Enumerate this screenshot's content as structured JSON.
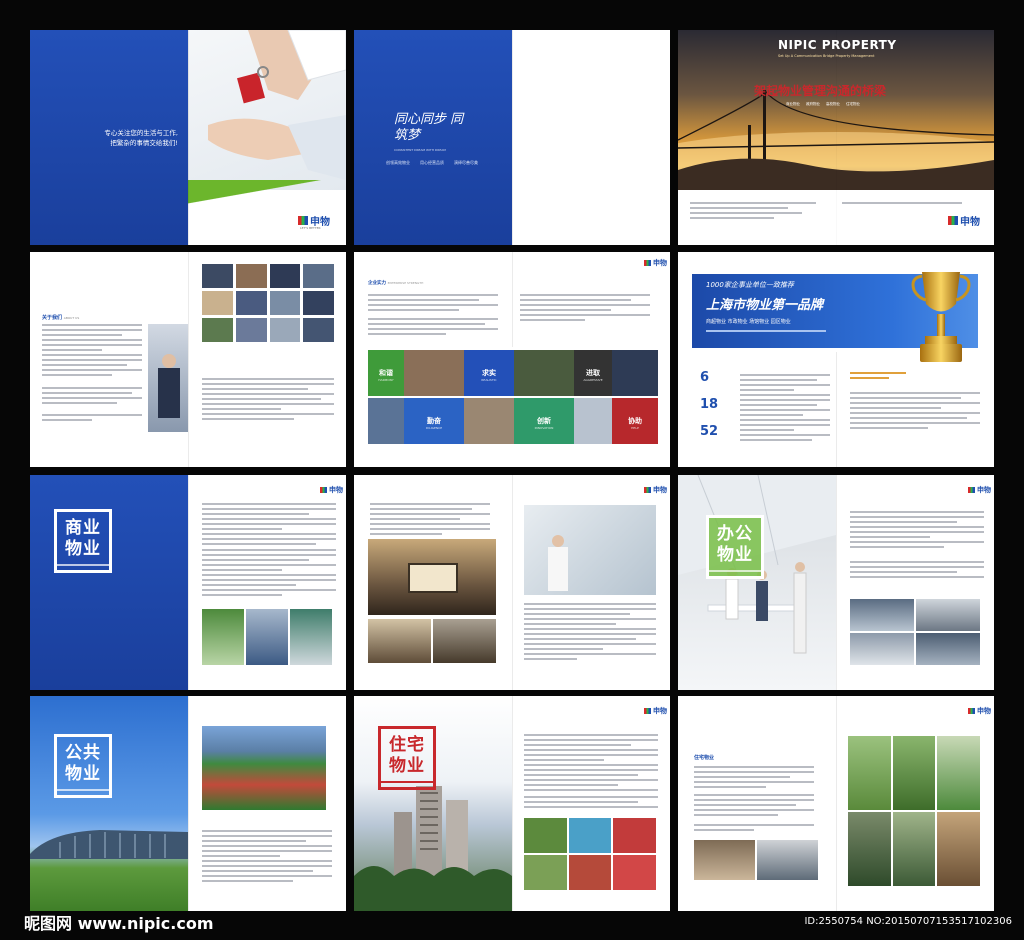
{
  "colors": {
    "brand_blue": "#1f4fae",
    "brand_red": "#c8282c",
    "brand_green": "#6cb62c"
  },
  "brand": {
    "name": "申物",
    "tagline": "LET'S BETTER"
  },
  "spread1": {
    "slogan_line1": "专心关注您的生活与工作,",
    "slogan_line2": "把繁杂的事情交给我们!"
  },
  "spread2": {
    "calligraphy": "同心同步 同筑梦",
    "subtitle_en": "CONSISTENT DREAM WITH DREAM",
    "slogans": [
      "创领高效物业",
      "用心经营品质",
      "演绎尽善尽美"
    ]
  },
  "spread3": {
    "title_en": "NIPIC PROPERTY",
    "subtitle_en": "Set Up A Communication Bridge Property Management",
    "headline": "架起物业管理沟通的桥梁",
    "tags": [
      "商业物业",
      "政府物业",
      "高校物业",
      "住宅物业"
    ]
  },
  "spread4": {
    "heading": "关于我们",
    "heading_en": "ABOUT US"
  },
  "spread5": {
    "heading": "企业实力",
    "heading_en": "ENTERPRISE STRENGTH",
    "values": [
      {
        "cn": "和谐",
        "en": "HARMONY"
      },
      {
        "cn": "求实",
        "en": "REALISTIC"
      },
      {
        "cn": "进取",
        "en": "AGGRESSIVE"
      },
      {
        "cn": "勤奋",
        "en": "DILIGENCE"
      },
      {
        "cn": "创新",
        "en": "INNOVATION"
      },
      {
        "cn": "协助",
        "en": "HELP"
      }
    ]
  },
  "spread6": {
    "banner_top": "1000家企事业单位一致推荐",
    "banner_main": "上海市物业第一品牌",
    "banner_sub": "商超物业 市政物业 场馆物业 园区物业",
    "stats": [
      "6",
      "18",
      "52"
    ]
  },
  "stamps": {
    "commercial": [
      "商业",
      "物业"
    ],
    "office": [
      "办公",
      "物业"
    ],
    "public": [
      "公共",
      "物业"
    ],
    "residential": [
      "住宅",
      "物业"
    ]
  },
  "spread12": {
    "heading": "住宅物业"
  },
  "watermark": {
    "site": "昵图网 www.nipic.com",
    "id": "ID:2550754 NO:20150707153517102306"
  }
}
